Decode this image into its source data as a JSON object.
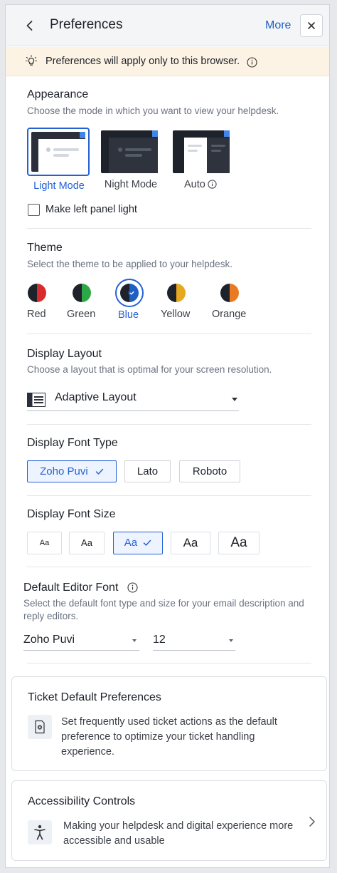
{
  "header": {
    "title": "Preferences",
    "more_label": "More"
  },
  "notice": {
    "text": "Preferences will apply only to this browser."
  },
  "appearance": {
    "title": "Appearance",
    "subtitle": "Choose the mode in which you want to view your helpdesk.",
    "modes": [
      {
        "label": "Light Mode",
        "selected": true
      },
      {
        "label": "Night Mode",
        "selected": false
      },
      {
        "label": "Auto",
        "selected": false
      }
    ],
    "left_panel_label": "Make left panel light",
    "left_panel_checked": false
  },
  "theme": {
    "title": "Theme",
    "subtitle": "Select the theme to be applied to your helpdesk.",
    "options": [
      {
        "label": "Red",
        "color": "#d92b2b",
        "selected": false
      },
      {
        "label": "Green",
        "color": "#2ea845",
        "selected": false
      },
      {
        "label": "Blue",
        "color": "#1f5fc3",
        "selected": true
      },
      {
        "label": "Yellow",
        "color": "#e6a81e",
        "selected": false
      },
      {
        "label": "Orange",
        "color": "#ea7a22",
        "selected": false
      }
    ]
  },
  "display_layout": {
    "title": "Display Layout",
    "subtitle": "Choose a layout that is optimal for your screen resolution.",
    "selected": "Adaptive Layout"
  },
  "font_type": {
    "title": "Display Font Type",
    "options": [
      {
        "label": "Zoho Puvi",
        "selected": true
      },
      {
        "label": "Lato",
        "selected": false
      },
      {
        "label": "Roboto",
        "selected": false
      }
    ]
  },
  "font_size": {
    "title": "Display Font Size",
    "options": [
      {
        "label": "Aa",
        "selected": false
      },
      {
        "label": "Aa",
        "selected": false
      },
      {
        "label": "Aa",
        "selected": true
      },
      {
        "label": "Aa",
        "selected": false
      },
      {
        "label": "Aa",
        "selected": false
      }
    ]
  },
  "editor_font": {
    "title": "Default Editor Font",
    "subtitle": "Select the default font type and size for your email description and reply editors.",
    "font": "Zoho Puvi",
    "size": "12"
  },
  "ticket_prefs": {
    "title": "Ticket Default Preferences",
    "description": "Set frequently used ticket actions as the default preference to optimize your ticket handling experience."
  },
  "accessibility": {
    "title": "Accessibility Controls",
    "description": "Making your helpdesk and digital experience more accessible and usable"
  },
  "colors": {
    "accent": "#2462d4",
    "notice_bg": "#fdf3e5"
  }
}
